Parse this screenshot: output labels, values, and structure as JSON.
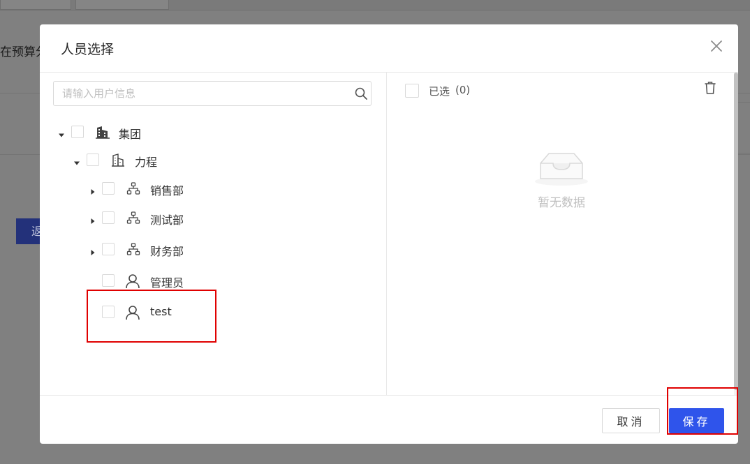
{
  "background": {
    "partial_text": "在预算分",
    "button_partial_label": "返"
  },
  "dialog": {
    "title": "人员选择",
    "close_icon": "close-icon",
    "search": {
      "placeholder": "请输入用户信息",
      "value": "",
      "icon": "search-icon"
    },
    "tree": {
      "root": {
        "label": "集团",
        "icon": "building-icon",
        "expanded": true,
        "checked": false
      },
      "company": {
        "label": "力程",
        "icon": "building-outline-icon",
        "expanded": true,
        "checked": false
      },
      "departments": [
        {
          "label": "销售部",
          "icon": "org-chart-icon",
          "expanded": false,
          "checked": false
        },
        {
          "label": "测试部",
          "icon": "org-chart-icon",
          "expanded": false,
          "checked": false
        },
        {
          "label": "财务部",
          "icon": "org-chart-icon",
          "expanded": false,
          "checked": false
        }
      ],
      "users": [
        {
          "label": "管理员",
          "icon": "user-icon",
          "checked": false
        },
        {
          "label": "test",
          "icon": "user-icon",
          "checked": false
        }
      ]
    },
    "selected_panel": {
      "label": "已选",
      "count": "(0)",
      "clear_icon": "trash-icon",
      "empty_text": "暂无数据",
      "empty_icon": "inbox-empty-icon"
    },
    "footer": {
      "cancel_label": "取消",
      "save_label": "保存"
    }
  },
  "colors": {
    "primary": "#2f54eb",
    "highlight": "#e00000",
    "overlay": "#808080",
    "border": "#d9d9d9"
  }
}
